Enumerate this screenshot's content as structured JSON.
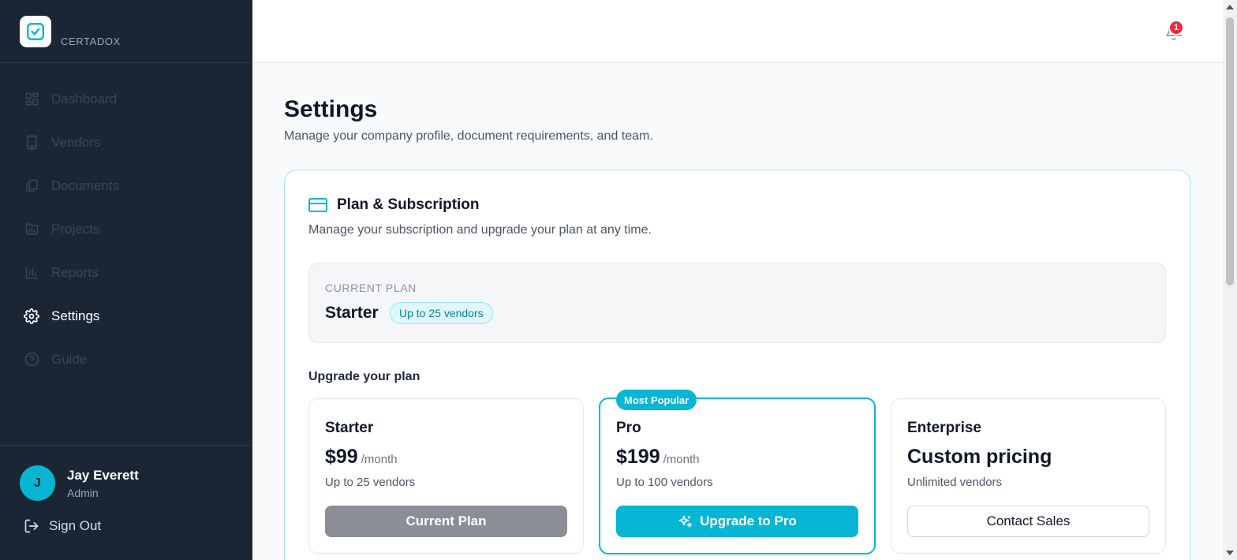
{
  "brand": {
    "name": "CERTADOX"
  },
  "nav": [
    {
      "label": "Dashboard",
      "icon": "dashboard-icon"
    },
    {
      "label": "Vendors",
      "icon": "building-icon"
    },
    {
      "label": "Documents",
      "icon": "documents-icon"
    },
    {
      "label": "Projects",
      "icon": "folder-icon"
    },
    {
      "label": "Reports",
      "icon": "bar-chart-icon"
    },
    {
      "label": "Settings",
      "icon": "gear-icon",
      "active": true
    },
    {
      "label": "Guide",
      "icon": "help-circle-icon"
    }
  ],
  "user": {
    "initial": "J",
    "name": "Jay Everett",
    "role": "Admin"
  },
  "signout": {
    "label": "Sign Out"
  },
  "topbar": {
    "notification_count": "1"
  },
  "page": {
    "title": "Settings",
    "subtitle": "Manage your company profile, document requirements, and team."
  },
  "subscription": {
    "title": "Plan & Subscription",
    "subtitle": "Manage your subscription and upgrade your plan at any time.",
    "current_label": "CURRENT PLAN",
    "current_name": "Starter",
    "current_badge": "Up to 25 vendors",
    "upgrade_label": "Upgrade your plan",
    "plans": [
      {
        "name": "Starter",
        "price": "$99",
        "period": "/month",
        "desc": "Up to 25 vendors",
        "button": "Current Plan"
      },
      {
        "name": "Pro",
        "price": "$199",
        "period": "/month",
        "desc": "Up to 100 vendors",
        "button": "Upgrade to Pro",
        "tag": "Most Popular"
      },
      {
        "name": "Enterprise",
        "price": "Custom pricing",
        "period": "",
        "desc": "Unlimited vendors",
        "button": "Contact Sales"
      }
    ]
  },
  "colors": {
    "accent": "#06b6d4",
    "sidebar": "#1b2635",
    "badge_red": "#ef2b3a"
  }
}
